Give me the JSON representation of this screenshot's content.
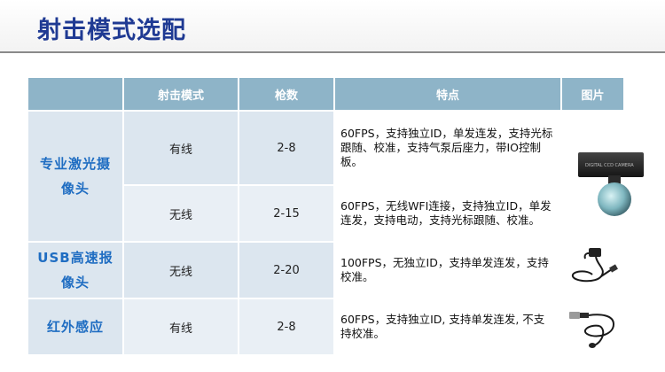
{
  "page": {
    "title": "射击模式选配"
  },
  "table": {
    "headers": [
      "",
      "射击模式",
      "枪数",
      "特点",
      "图片"
    ],
    "rows": [
      {
        "category": "专业激光摄像头",
        "mode": "有线",
        "count": "2-8",
        "features": "60FPS，支持独立ID，单发连发，支持光标跟随、校准，支持气泵后座力，带IO控制板。"
      },
      {
        "mode": "无线",
        "count": "2-15",
        "features": "60FPS，无线WFI连接，支持独立ID，单发连发，支持电动，支持光标跟随、校准。"
      },
      {
        "category": "USB高速报像头",
        "mode": "无线",
        "count": "2-20",
        "features": "100FPS，无独立ID，支持单发连发，支持校准。"
      },
      {
        "category": "红外感应",
        "mode": "有线",
        "count": "2-8",
        "features": "60FPS，支持独立ID, 支持单发连发, 不支持校准。"
      }
    ],
    "camera_label": "DIGITAL CCD CAMERA"
  }
}
